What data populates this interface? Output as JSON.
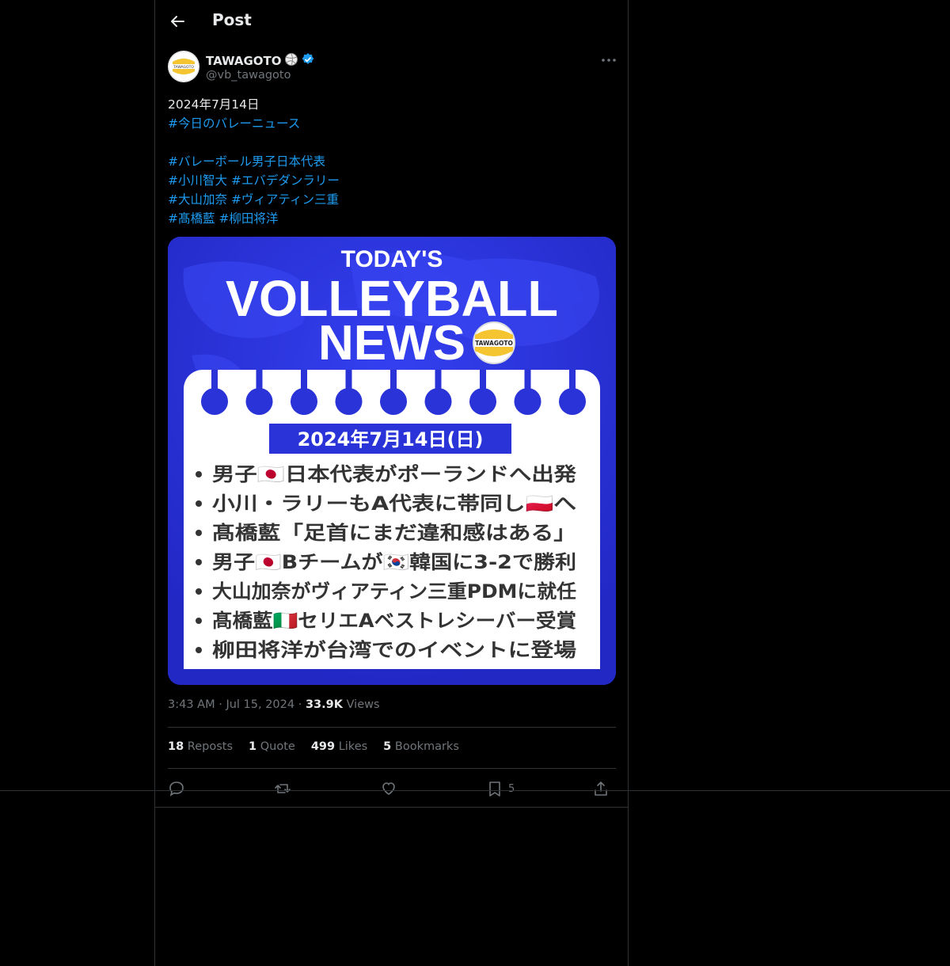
{
  "header": {
    "title": "Post"
  },
  "author": {
    "name": "TAWAGOTO",
    "handle": "@vb_tawagoto",
    "avatar_text": "TAWAGOTO"
  },
  "tweet": {
    "date_line": "2024年7月14日",
    "hashtags": [
      [
        "#今日のバレーニュース"
      ],
      [],
      [
        "#バレーボール男子日本代表"
      ],
      [
        "#小川智大",
        "#エバデダンラリー"
      ],
      [
        "#大山加奈",
        "#ヴィアティン三重"
      ],
      [
        "#髙橋藍",
        "#柳田将洋"
      ]
    ]
  },
  "card": {
    "line1": "TODAY'S",
    "line2": "VOLLEYBALL",
    "line3": "NEWS",
    "badge": "TAWAGOTO",
    "date": "2024年7月14日(日)",
    "items": [
      "男子🇯🇵日本代表がポーランドへ出発",
      "小川・ラリーもA代表に帯同し🇵🇱へ",
      "髙橋藍「足首にまだ違和感はある」",
      "男子🇯🇵Bチームが🇰🇷韓国に3-2で勝利",
      "大山加奈がヴィアティン三重PDMに就任",
      "髙橋藍🇮🇹セリエAベストレシーバー受賞",
      "柳田将洋が台湾でのイベントに登場"
    ]
  },
  "meta": {
    "time": "3:43 AM",
    "dot": "·",
    "date": "Jul 15, 2024",
    "views_count": "33.9K",
    "views_label": "Views"
  },
  "stats": [
    {
      "count": "18",
      "label": "Reposts"
    },
    {
      "count": "1",
      "label": "Quote"
    },
    {
      "count": "499",
      "label": "Likes"
    },
    {
      "count": "5",
      "label": "Bookmarks"
    }
  ],
  "actions": {
    "bookmark_count": "5"
  },
  "colors": {
    "accent": "#1d9bf0",
    "verified": "#1d9bf0",
    "card_blue": "#2a33d8",
    "text_muted": "#71767b"
  }
}
